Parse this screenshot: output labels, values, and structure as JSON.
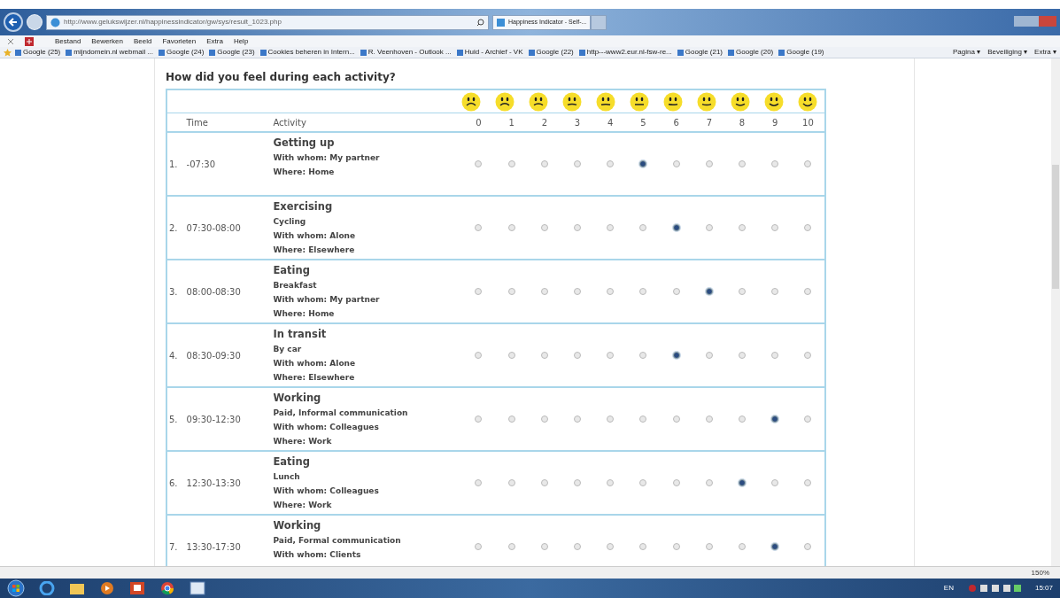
{
  "browser": {
    "address": "http://www.gelukswijzer.nl/happinessindicator/gw/sys/result_1023.php",
    "tabs": [
      {
        "label": "Happiness Indicator - Self-...",
        "selected": true
      }
    ],
    "menu": [
      "Bestand",
      "Bewerken",
      "Beeld",
      "Favorieten",
      "Extra",
      "Help"
    ],
    "bookmarks": [
      "Google (25)",
      "mijndomein.nl webmail ...",
      "Google (24)",
      "Google (23)",
      "Cookies beheren in Intern...",
      "R. Veenhoven - Outlook ...",
      "Huid - Archief - VK",
      "Google (22)",
      "http---www2.eur.nl-fsw-re...",
      "Google (21)",
      "Google (20)",
      "Google (19)"
    ],
    "tools": [
      "Pagina ▾",
      "Beveiliging ▾",
      "Extra ▾"
    ],
    "zoom": "150%"
  },
  "page": {
    "heading": "How did you feel during each activity?",
    "columns": {
      "time": "Time",
      "activity": "Activity",
      "scale": [
        "0",
        "1",
        "2",
        "3",
        "4",
        "5",
        "6",
        "7",
        "8",
        "9",
        "10"
      ]
    },
    "rows": [
      {
        "number": "1.",
        "time": "-07:30",
        "activity": "Getting up",
        "details": [
          "With whom: My partner",
          "Where: Home"
        ],
        "rating": [
          {
            "selected": false
          },
          {
            "selected": false
          },
          {
            "selected": false
          },
          {
            "selected": false
          },
          {
            "selected": false
          },
          {
            "selected": true
          },
          {
            "selected": false
          },
          {
            "selected": false
          },
          {
            "selected": false
          },
          {
            "selected": false
          },
          {
            "selected": false
          }
        ]
      },
      {
        "number": "2.",
        "time": "07:30-08:00",
        "activity": "Exercising",
        "details": [
          "Cycling",
          "With whom: Alone",
          "Where: Elsewhere"
        ],
        "rating": [
          {
            "selected": false
          },
          {
            "selected": false
          },
          {
            "selected": false
          },
          {
            "selected": false
          },
          {
            "selected": false
          },
          {
            "selected": false
          },
          {
            "selected": true
          },
          {
            "selected": false
          },
          {
            "selected": false
          },
          {
            "selected": false
          },
          {
            "selected": false
          }
        ]
      },
      {
        "number": "3.",
        "time": "08:00-08:30",
        "activity": "Eating",
        "details": [
          "Breakfast",
          "With whom: My partner",
          "Where: Home"
        ],
        "rating": [
          {
            "selected": false
          },
          {
            "selected": false
          },
          {
            "selected": false
          },
          {
            "selected": false
          },
          {
            "selected": false
          },
          {
            "selected": false
          },
          {
            "selected": false
          },
          {
            "selected": true
          },
          {
            "selected": false
          },
          {
            "selected": false
          },
          {
            "selected": false
          }
        ]
      },
      {
        "number": "4.",
        "time": "08:30-09:30",
        "activity": "In transit",
        "details": [
          "By car",
          "With whom: Alone",
          "Where: Elsewhere"
        ],
        "rating": [
          {
            "selected": false
          },
          {
            "selected": false
          },
          {
            "selected": false
          },
          {
            "selected": false
          },
          {
            "selected": false
          },
          {
            "selected": false
          },
          {
            "selected": true
          },
          {
            "selected": false
          },
          {
            "selected": false
          },
          {
            "selected": false
          },
          {
            "selected": false
          }
        ]
      },
      {
        "number": "5.",
        "time": "09:30-12:30",
        "activity": "Working",
        "details": [
          "Paid, Informal communication",
          "With whom: Colleagues",
          "Where: Work"
        ],
        "rating": [
          {
            "selected": false
          },
          {
            "selected": false
          },
          {
            "selected": false
          },
          {
            "selected": false
          },
          {
            "selected": false
          },
          {
            "selected": false
          },
          {
            "selected": false
          },
          {
            "selected": false
          },
          {
            "selected": false
          },
          {
            "selected": true
          },
          {
            "selected": false
          }
        ]
      },
      {
        "number": "6.",
        "time": "12:30-13:30",
        "activity": "Eating",
        "details": [
          "Lunch",
          "With whom: Colleagues",
          "Where: Work"
        ],
        "rating": [
          {
            "selected": false
          },
          {
            "selected": false
          },
          {
            "selected": false
          },
          {
            "selected": false
          },
          {
            "selected": false
          },
          {
            "selected": false
          },
          {
            "selected": false
          },
          {
            "selected": false
          },
          {
            "selected": true
          },
          {
            "selected": false
          },
          {
            "selected": false
          }
        ]
      },
      {
        "number": "7.",
        "time": "13:30-17:30",
        "activity": "Working",
        "details": [
          "Paid, Formal communication",
          "With whom: Clients"
        ],
        "rating": [
          {
            "selected": false
          },
          {
            "selected": false
          },
          {
            "selected": false
          },
          {
            "selected": false
          },
          {
            "selected": false
          },
          {
            "selected": false
          },
          {
            "selected": false
          },
          {
            "selected": false
          },
          {
            "selected": false
          },
          {
            "selected": true
          },
          {
            "selected": false
          }
        ]
      }
    ]
  },
  "taskbar": {
    "language": "EN",
    "clock": "15:07"
  }
}
